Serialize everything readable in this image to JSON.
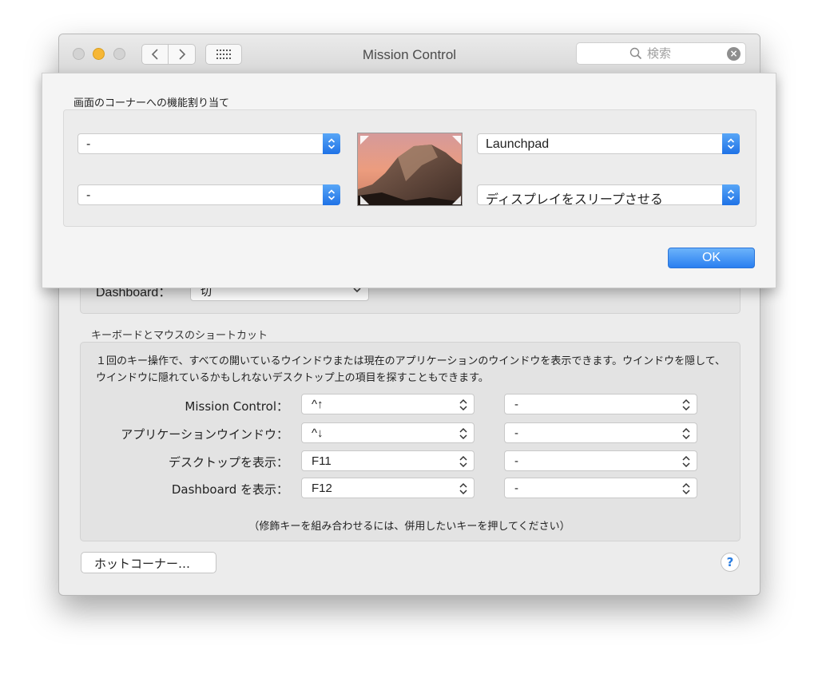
{
  "window": {
    "title": "Mission Control",
    "search": {
      "placeholder": "検索"
    }
  },
  "behind": {
    "dashboard_label": "Dashboard：",
    "dashboard_value": "切"
  },
  "shortcuts": {
    "section_title": "キーボードとマウスのショートカット",
    "description": "１回のキー操作で、すべての開いているウインドウまたは現在のアプリケーションのウインドウを表示できます。ウインドウを隠して、ウインドウに隠れているかもしれないデスクトップ上の項目を探すこともできます。",
    "rows": [
      {
        "label": "Mission Control：",
        "key": "^↑",
        "mouse": "-"
      },
      {
        "label": "アプリケーションウインドウ：",
        "key": "^↓",
        "mouse": "-"
      },
      {
        "label": "デスクトップを表示：",
        "key": "F11",
        "mouse": "-"
      },
      {
        "label": "Dashboard を表示：",
        "key": "F12",
        "mouse": "-"
      }
    ],
    "hint": "（修飾キーを組み合わせるには、併用したいキーを押してください）",
    "hot_corners_button": "ホットコーナー…",
    "help": "?"
  },
  "sheet": {
    "title": "画面のコーナーへの機能割り当て",
    "top_left": "-",
    "bottom_left": "-",
    "top_right": "Launchpad",
    "bottom_right": "ディスプレイをスリープさせる",
    "ok": "OK"
  },
  "colors": {
    "accent": "#2a7ff0",
    "minimize": "#f6b736"
  }
}
